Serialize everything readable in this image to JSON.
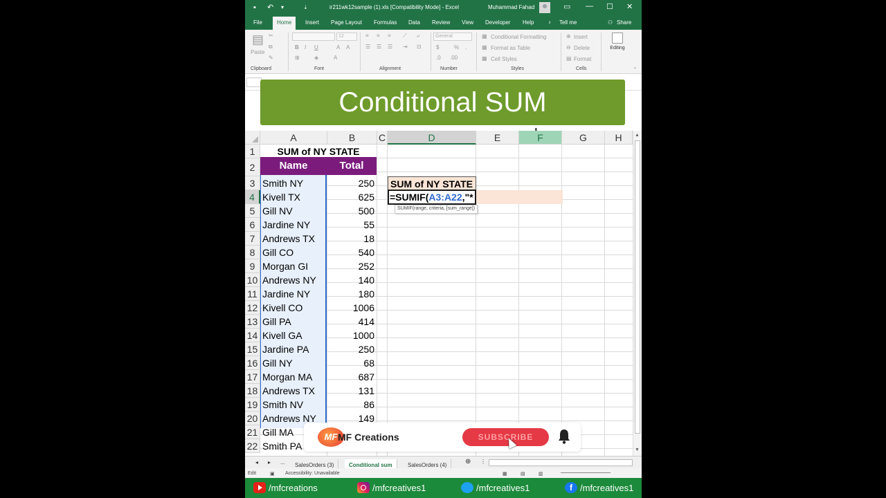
{
  "window": {
    "title": "ir211wk12sample (1).xls  [Compatibility Mode]  -  Excel",
    "user": "Muhammad Fahad"
  },
  "ribbon": {
    "tabs": [
      "File",
      "Home",
      "Insert",
      "Page Layout",
      "Formulas",
      "Data",
      "Review",
      "View",
      "Developer",
      "Help",
      "Tell me",
      "Share"
    ],
    "active_tab": "Home",
    "groups": [
      "Clipboard",
      "Font",
      "Alignment",
      "Number",
      "Styles",
      "Cells"
    ],
    "paste_label": "Paste",
    "font_size": "12",
    "number_format": "General",
    "styles_items": [
      "Conditional Formatting",
      "Format as Table",
      "Cell Styles"
    ],
    "cells_items": [
      "Insert",
      "Delete",
      "Format"
    ],
    "editing_label": "Editing"
  },
  "banner": {
    "text": "Conditional SUM"
  },
  "grid": {
    "columns": [
      "A",
      "B",
      "C",
      "D",
      "E",
      "F",
      "G",
      "H"
    ],
    "rows": [
      "1",
      "2",
      "3",
      "4",
      "5",
      "6",
      "7",
      "8",
      "9",
      "10",
      "11",
      "12",
      "13",
      "14",
      "15",
      "16",
      "17",
      "18",
      "19",
      "20",
      "21",
      "22"
    ],
    "title_cell": "SUM of NY STATE",
    "header_name": "Name",
    "header_total": "Total",
    "data": [
      {
        "name": "Smith NY",
        "total": "250"
      },
      {
        "name": "Kivell TX",
        "total": "625"
      },
      {
        "name": "Gill NV",
        "total": "500"
      },
      {
        "name": "Jardine NY",
        "total": "55"
      },
      {
        "name": "Andrews TX",
        "total": "18"
      },
      {
        "name": "Gill CO",
        "total": "540"
      },
      {
        "name": "Morgan GI",
        "total": "252"
      },
      {
        "name": "Andrews NY",
        "total": "140"
      },
      {
        "name": "Jardine NY",
        "total": "180"
      },
      {
        "name": "Kivell CO",
        "total": "1006"
      },
      {
        "name": "Gill PA",
        "total": "414"
      },
      {
        "name": "Kivell GA",
        "total": "1000"
      },
      {
        "name": "Jardine PA",
        "total": "250"
      },
      {
        "name": "Gill NY",
        "total": "68"
      },
      {
        "name": "Morgan MA",
        "total": "687"
      },
      {
        "name": "Andrews TX",
        "total": "131"
      },
      {
        "name": "Smith NV",
        "total": "86"
      },
      {
        "name": "Andrews NY",
        "total": "149"
      },
      {
        "name": "Gill MA",
        "total": ""
      },
      {
        "name": "Smith PA",
        "total": ""
      }
    ],
    "d3_label": "SUM of NY STATE",
    "formula_prefix": "=SUMIF(",
    "formula_ref": "A3:A22",
    "formula_suffix": ",\"*",
    "tooltip": "SUMIF(range, criteria, [sum_range])"
  },
  "sheets": {
    "ellipsis": "...",
    "tabs": [
      "SalesOrders (3)",
      "Conditional sum",
      "SalesOrders (4)"
    ],
    "active": "Conditional sum"
  },
  "status": {
    "mode": "Edit",
    "accessibility": "Accessibility: Unavailable"
  },
  "overlay": {
    "logo_text": "MF",
    "brand": "MF Creations",
    "subscribe": "SUBSCRIBE"
  },
  "footer": {
    "youtube": "/mfcreations",
    "instagram": "/mfcreatives1",
    "twitter": "/mfcreatives1",
    "facebook": "/mfcreatives1"
  },
  "colors": {
    "excel_green": "#217346",
    "banner_green": "#6e9b2b",
    "header_purple": "#7b1c7d",
    "peach": "#fbe5d6",
    "footer_green": "#1c8a3b"
  }
}
